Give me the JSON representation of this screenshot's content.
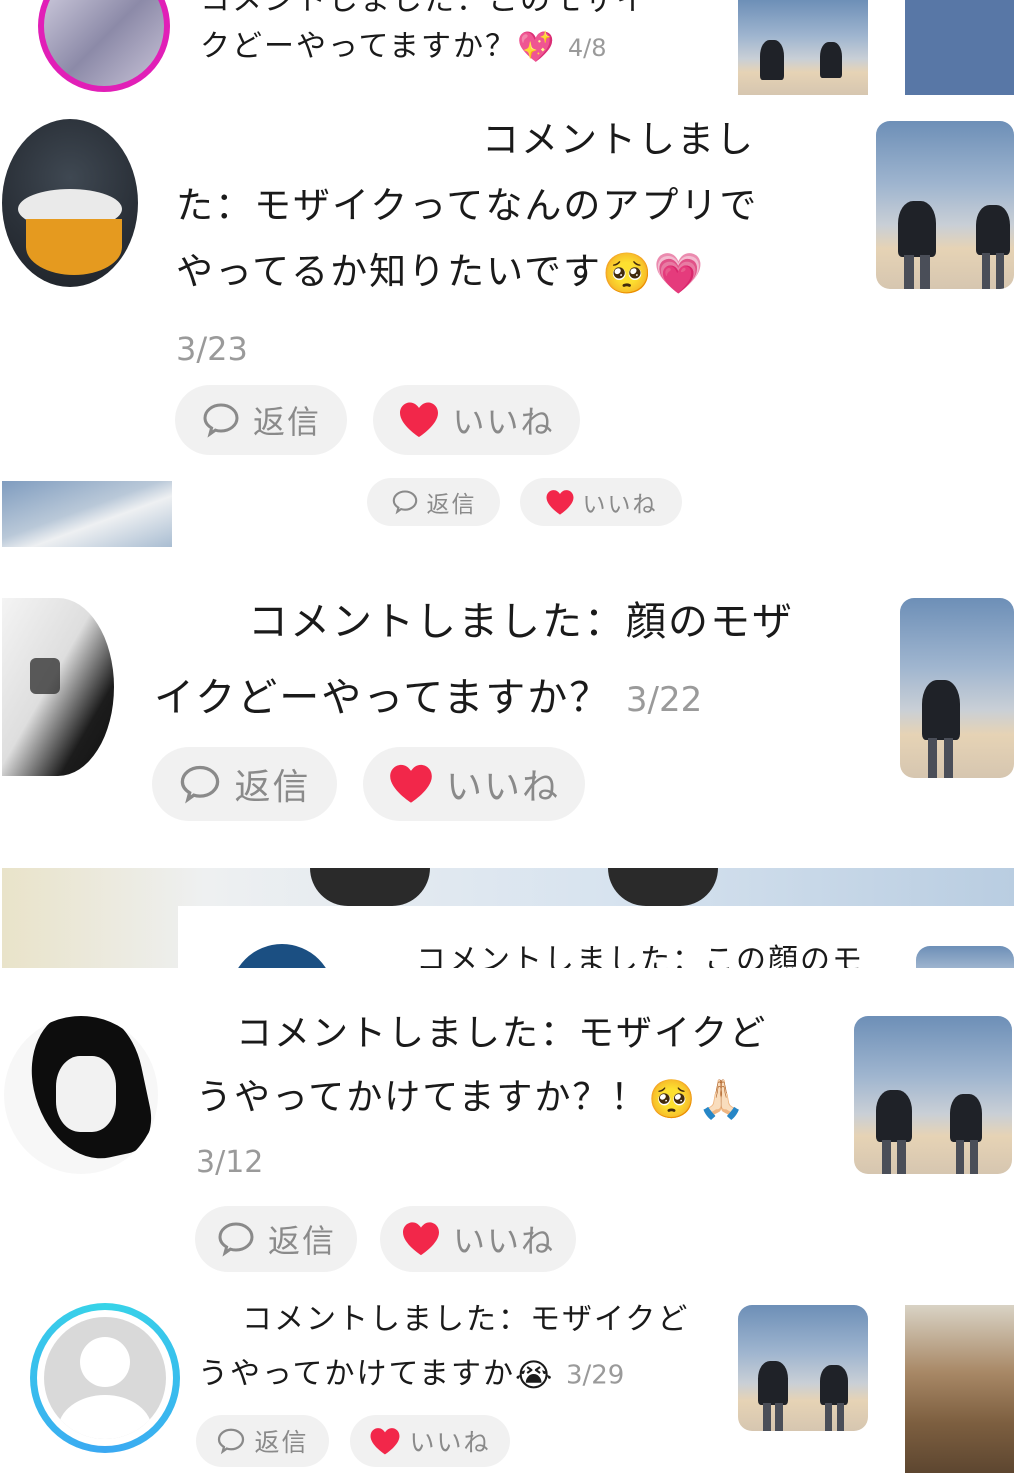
{
  "comments": [
    {
      "text_lines": [
        "コメントしました：このモザイ",
        "クどーやってますか？"
      ],
      "emoji": "💖",
      "date": "4/8"
    },
    {
      "text_lines": [
        "コメントしまし",
        "た：モザイクってなんのアプリで",
        "やってるか知りたいです"
      ],
      "emoji": "🥺💗",
      "date": "3/23",
      "reply_label": "返信",
      "like_label": "いいね"
    },
    {
      "reply_label": "返信",
      "like_label": "いいね"
    },
    {
      "text_lines": [
        "コメントしました：顔のモザ",
        "イクどーやってますか？"
      ],
      "date": "3/22",
      "reply_label": "返信",
      "like_label": "いいね"
    },
    {
      "text_lines": [
        "コメントしました：この顔のモ"
      ]
    },
    {
      "text_lines": [
        "コメントしました：モザイクど",
        "うやってかけてますか？！"
      ],
      "emoji": "🥺🙏🏻",
      "date": "3/12",
      "reply_label": "返信",
      "like_label": "いいね"
    },
    {
      "text_lines": [
        "コメントしました：モザイクど",
        "うやってかけてますか"
      ],
      "emoji": "😭",
      "date": "3/29",
      "reply_label": "返信",
      "like_label": "いいね"
    }
  ],
  "icons": {
    "reply": "speech-bubble-icon",
    "like": "heart-icon"
  },
  "colors": {
    "like_heart": "#f2274a",
    "pill_bg": "#f1f1f1",
    "date_gray": "#9a9a9a"
  }
}
